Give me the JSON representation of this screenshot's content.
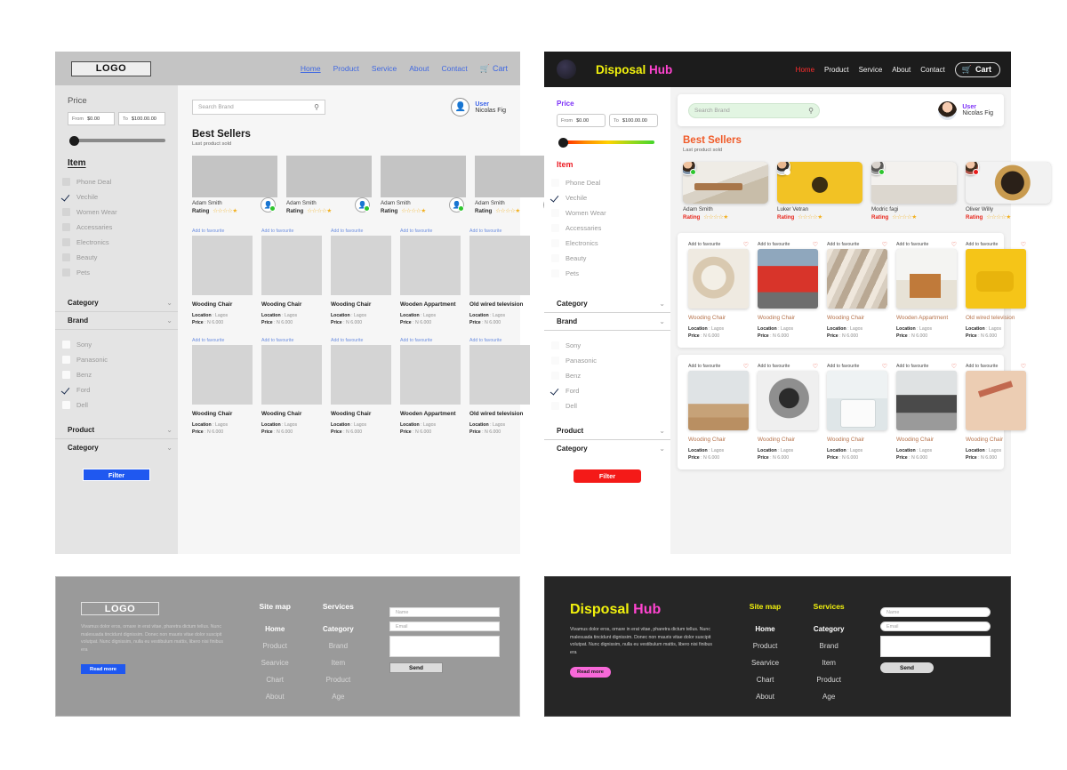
{
  "wireframe": {
    "logo": "LOGO",
    "nav": [
      "Home",
      "Product",
      "Service",
      "About",
      "Contact"
    ],
    "cart": "Cart",
    "search_placeholder": "Search Brand",
    "user": {
      "label": "User",
      "name": "Nicolas Fig"
    },
    "section": {
      "title": "Best Sellers",
      "subtitle": "Last product sold"
    },
    "sidebar": {
      "price_title": "Price",
      "from_label": "From",
      "from_value": "$0.00",
      "to_label": "To",
      "to_value": "$100.00.00",
      "item_title": "Item",
      "items": [
        {
          "label": "Phone Deal",
          "checked": false
        },
        {
          "label": "Vechile",
          "checked": true
        },
        {
          "label": "Women Wear",
          "checked": false
        },
        {
          "label": "Accessaries",
          "checked": false
        },
        {
          "label": "Electronics",
          "checked": false
        },
        {
          "label": "Beauty",
          "checked": false
        },
        {
          "label": "Pets",
          "checked": false
        }
      ],
      "accordion_1": [
        "Category",
        "Brand"
      ],
      "brands": [
        {
          "label": "Sony",
          "checked": false
        },
        {
          "label": "Panasonic",
          "checked": false
        },
        {
          "label": "Benz",
          "checked": false
        },
        {
          "label": "Ford",
          "checked": true
        },
        {
          "label": "Dell",
          "checked": false
        }
      ],
      "accordion_2": [
        "Product",
        "Category"
      ],
      "filter_button": "Filter"
    },
    "best_sellers": [
      {
        "name": "Adam Smith",
        "rating_label": "Rating",
        "stars": "☆☆☆☆★"
      },
      {
        "name": "Adam Smith",
        "rating_label": "Rating",
        "stars": "☆☆☆☆★"
      },
      {
        "name": "Adam Smith",
        "rating_label": "Rating",
        "stars": "☆☆☆☆★"
      },
      {
        "name": "Adam Smith",
        "rating_label": "Rating",
        "stars": "☆☆☆☆★"
      }
    ],
    "fav_label": "Add to favourite",
    "location_label": "Location",
    "location_value": "Lagos",
    "price_label": "Price",
    "price_value": "N 6.000",
    "products_row1": [
      "Wooding Chair",
      "Wooding Chair",
      "Wooding Chair",
      "Wooden Appartment",
      "Old wired  television"
    ],
    "products_row2": [
      "Wooding Chair",
      "Wooding Chair",
      "Wooding Chair",
      "Wooden Appartment",
      "Old wired  television"
    ],
    "footer": {
      "logo": "LOGO",
      "paragraph": "Vivamus dolor eros, ornare in erat vitae, pharetra dictum tellus. Nunc malesuada tincidunt dignissim. Donec non mauris vitae dolor suscipit volutpat. Nunc dignissim, nulla eu vestibulum mattis, libero nisi finibus era",
      "read_more": "Read more",
      "col1_title": "Site map",
      "col1": [
        "Home",
        "Product",
        "Searvice",
        "Chart",
        "About"
      ],
      "col2_title": "Services",
      "col2": [
        "Category",
        "Brand",
        "Item",
        "Product",
        "Age"
      ],
      "name_placeholder": "Name",
      "email_placeholder": "Email",
      "send": "Send"
    }
  },
  "styled": {
    "brand": {
      "first": "Disposal",
      "second": "Hub"
    },
    "nav": [
      "Home",
      "Product",
      "Service",
      "About",
      "Contact"
    ],
    "cart": "Cart",
    "search_placeholder": "Search Brand",
    "user": {
      "label": "User",
      "name": "Nicolas Fig"
    },
    "section": {
      "title": "Best Sellers",
      "subtitle": "Last product sold"
    },
    "sidebar": {
      "price_title": "Price",
      "from_label": "From",
      "from_value": "$0.00",
      "to_label": "To",
      "to_value": "$100.00.00",
      "item_title": "Item",
      "items": [
        {
          "label": "Phone Deal",
          "checked": false
        },
        {
          "label": "Vechile",
          "checked": true
        },
        {
          "label": "Women Wear",
          "checked": false
        },
        {
          "label": "Accessaries",
          "checked": false
        },
        {
          "label": "Electronics",
          "checked": false
        },
        {
          "label": "Beauty",
          "checked": false
        },
        {
          "label": "Pets",
          "checked": false
        }
      ],
      "accordion_1": [
        "Category",
        "Brand"
      ],
      "brands": [
        {
          "label": "Sony",
          "checked": false
        },
        {
          "label": "Panasonic",
          "checked": false
        },
        {
          "label": "Benz",
          "checked": false
        },
        {
          "label": "Ford",
          "checked": true
        },
        {
          "label": "Dell",
          "checked": false
        }
      ],
      "accordion_2": [
        "Product",
        "Category"
      ],
      "filter_button": "Filter"
    },
    "best_sellers": [
      {
        "name": "Adam Smith",
        "rating_label": "Rating",
        "stars": "☆☆☆☆★",
        "status": "#2ec52e",
        "img": "ph-room",
        "av": "av-a"
      },
      {
        "name": "Luker Vetran",
        "rating_label": "Rating",
        "stars": "☆☆☆☆★",
        "status": "#ffffff",
        "img": "ph-sun",
        "av": "av-b"
      },
      {
        "name": "Modric fagi",
        "rating_label": "Rating",
        "stars": "☆☆☆☆★",
        "status": "#2ec52e",
        "img": "ph-bags",
        "av": "av-c"
      },
      {
        "name": "Oliver Willy",
        "rating_label": "Rating",
        "stars": "☆☆☆☆★",
        "status": "#e81b1b",
        "img": "ph-watch",
        "av": "av-d"
      }
    ],
    "fav_label": "Add to favourite",
    "location_label": "Location",
    "location_value": "Lagos",
    "price_label": "Price",
    "price_value": "N 6.000",
    "products_row1": [
      {
        "name": "Wooding Chair",
        "img": "ph-flower"
      },
      {
        "name": "Wooding Chair",
        "img": "ph-car"
      },
      {
        "name": "Wooding Chair",
        "img": "ph-fabric"
      },
      {
        "name": "Wooden Appartment",
        "img": "ph-house"
      },
      {
        "name": "Old wired  television",
        "img": "ph-phone"
      }
    ],
    "products_row2": [
      {
        "name": "Wooding Chair",
        "img": "ph-chair"
      },
      {
        "name": "Wooding Chair",
        "img": "ph-camera"
      },
      {
        "name": "Wooding Chair",
        "img": "ph-washer"
      },
      {
        "name": "Wooding Chair",
        "img": "ph-coffee"
      },
      {
        "name": "Wooding Chair",
        "img": "ph-makeup"
      }
    ],
    "footer": {
      "brand_first": "Disposal",
      "brand_second": "Hub",
      "paragraph": "Vivamus dolor eros, ornare in erat vitae, pharetra dictum tellus. Nunc malesuada tincidunt dignissim. Donec non mauris vitae dolor suscipit volutpat. Nunc dignissim, nulla eu vestibulum mattis, libero nisi finibus era",
      "read_more": "Read more",
      "col1_title": "Site map",
      "col1": [
        "Home",
        "Product",
        "Searvice",
        "Chart",
        "About"
      ],
      "col2_title": "Services",
      "col2": [
        "Category",
        "Brand",
        "Item",
        "Product",
        "Age"
      ],
      "name_placeholder": "Name",
      "email_placeholder": "Email",
      "send": "Send"
    }
  },
  "colors": {
    "accent_blue": "#1f58f0",
    "accent_red": "#f41a18",
    "brand_yellow": "#f2f20d",
    "brand_pink": "#ff44d0",
    "orange": "#f05a28",
    "purple": "#7b2ff7"
  }
}
